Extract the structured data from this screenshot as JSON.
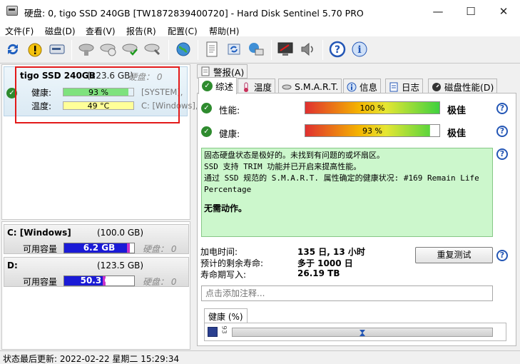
{
  "window": {
    "title": "硬盘:  0, tigo SSD 240GB [TW1872839400720]  -  Hard Disk Sentinel 5.70 PRO",
    "minimize": "—",
    "maximize": "☐",
    "close": "✕"
  },
  "menu": [
    "文件(F)",
    "磁盘(D)",
    "查看(V)",
    "报告(R)",
    "配置(C)",
    "帮助(H)"
  ],
  "toolbar": {
    "icons": [
      "refresh-icon",
      "warning-icon",
      "disk-icon",
      "disk-gray-icon",
      "disk-check-icon",
      "disk-ok-icon",
      "disk-tool-icon",
      "globe-icon",
      "report-icon",
      "sync-icon",
      "network-icon",
      "alert-monitor-icon",
      "speaker-icon",
      "help-icon",
      "info-icon"
    ]
  },
  "disk": {
    "name": "tigo SSD 240GB",
    "size": "(223.6 GB)",
    "disk_label": "硬盘： 0",
    "health_label": "健康:",
    "health_value": "93 %",
    "health_percent": 93,
    "health_color": "#7ee27e",
    "temp_label": "温度:",
    "temp_value": "49 °C",
    "temp_percent": 100,
    "temp_color": "#ffff99",
    "side1": "[SYSTEM],",
    "side2": "C: [Windows],"
  },
  "partitions": [
    {
      "name": "C: [Windows]",
      "size": "(100.0 GB)",
      "free_label": "可用容量",
      "free_value": "6.2 GB",
      "used_percent": 94,
      "fill_color": "#1a1ad6",
      "end_color": "#c933c9",
      "disk": "硬盘： 0"
    },
    {
      "name": "D:",
      "size": "(123.5 GB)",
      "free_label": "可用容量",
      "free_value": "50.3 GB",
      "used_percent": 59,
      "fill_color": "#1a1ad6",
      "end_color": "#c933c9",
      "disk": "硬盘： 0"
    }
  ],
  "status": {
    "text": "状态最后更新:   2022-02-22 星期二 15:29:34"
  },
  "tabs": {
    "alert": "警报(A)",
    "summary": "综述",
    "temperature": "温度",
    "smart": "S.M.A.R.T.",
    "info": "信息",
    "log": "日志",
    "disk_perf": "磁盘性能(D)"
  },
  "overview": {
    "perf_label": "性能:",
    "perf_value": "100 %",
    "perf_percent": 100,
    "perf_verdict": "极佳",
    "health_label": "健康:",
    "health_value": "93 %",
    "health_percent": 93,
    "health_verdict": "极佳",
    "messages": [
      "固态硬盘状态是极好的。未找到有问题的或坏扇区。",
      "SSD 支持 TRIM 功能并已开启来提高性能。",
      "通过 SSD 规范的 S.M.A.R.T. 属性确定的健康状况:   #169 Remain Life",
      "Percentage"
    ],
    "no_action": "无需动作。",
    "power_on_label": "加电时间:",
    "power_on_value": "135 日, 13 小时",
    "remaining_label": "预计的剩余寿命:",
    "remaining_value": "多于 1000 日",
    "writes_label": "寿命期写入:",
    "writes_value": "26.19 TB",
    "retest_button": "重复测试",
    "note_placeholder": "点击添加注释...",
    "health_graph_tab": "健康 (%)",
    "graph_axis": "93"
  }
}
